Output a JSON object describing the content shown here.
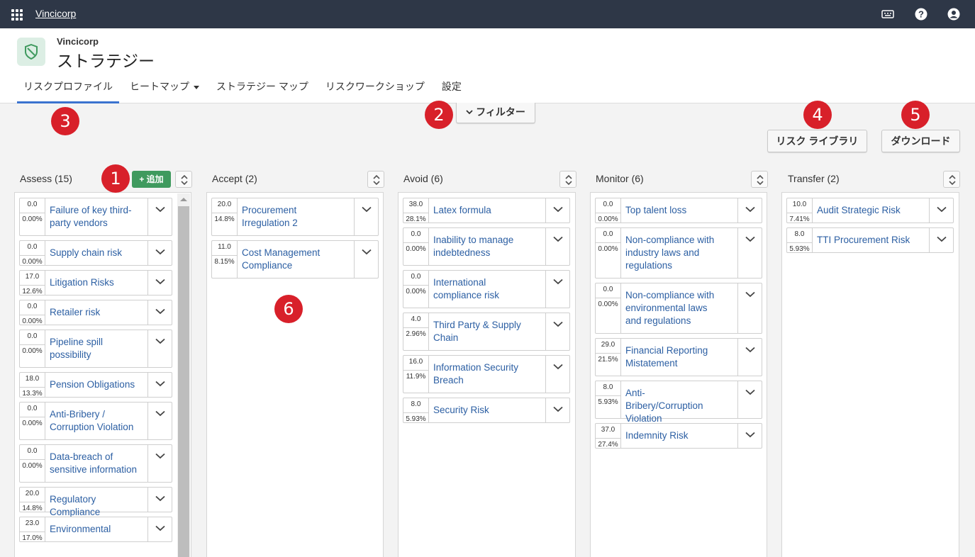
{
  "topbar": {
    "brand": "Vincicorp",
    "icons": [
      "apps-grid-icon",
      "keyboard-icon",
      "help-icon",
      "user-icon"
    ]
  },
  "header": {
    "org": "Vincicorp",
    "title": "ストラテジー"
  },
  "tabs": [
    {
      "label": "リスクプロファイル",
      "active": true
    },
    {
      "label": "ヒートマップ"
    },
    {
      "label": "ストラテジー マップ"
    },
    {
      "label": "リスクワークショップ"
    },
    {
      "label": "設定"
    }
  ],
  "filter_label": "フィルター",
  "buttons": {
    "library": "リスク ライブラリ",
    "download": "ダウンロード",
    "add": "+ 追加"
  },
  "callouts": [
    "1",
    "2",
    "3",
    "4",
    "5",
    "6"
  ],
  "columns": [
    {
      "title": "Assess (15)",
      "cards": [
        {
          "s1": "0.0",
          "s2": "0.00%",
          "name": "Failure of key third-party vendors"
        },
        {
          "s1": "0.0",
          "s2": "0.00%",
          "name": "Supply chain risk"
        },
        {
          "s1": "17.0",
          "s2": "12.6%",
          "name": "Litigation Risks"
        },
        {
          "s1": "0.0",
          "s2": "0.00%",
          "name": "Retailer risk"
        },
        {
          "s1": "0.0",
          "s2": "0.00%",
          "name": "Pipeline spill possibility"
        },
        {
          "s1": "18.0",
          "s2": "13.3%",
          "name": "Pension Obligations"
        },
        {
          "s1": "0.0",
          "s2": "0.00%",
          "name": "Anti-Bribery / Corruption Violation"
        },
        {
          "s1": "0.0",
          "s2": "0.00%",
          "name": "Data-breach of sensitive information"
        },
        {
          "s1": "20.0",
          "s2": "14.8%",
          "name": "Regulatory Compliance"
        },
        {
          "s1": "23.0",
          "s2": "17.0%",
          "name": "Environmental"
        }
      ]
    },
    {
      "title": "Accept (2)",
      "cards": [
        {
          "s1": "20.0",
          "s2": "14.8%",
          "name": "Procurement Irregulation 2"
        },
        {
          "s1": "11.0",
          "s2": "8.15%",
          "name": "Cost Management Compliance"
        }
      ]
    },
    {
      "title": "Avoid (6)",
      "cards": [
        {
          "s1": "38.0",
          "s2": "28.1%",
          "name": "Latex formula"
        },
        {
          "s1": "0.0",
          "s2": "0.00%",
          "name": "Inability to manage indebtedness"
        },
        {
          "s1": "0.0",
          "s2": "0.00%",
          "name": "International compliance risk"
        },
        {
          "s1": "4.0",
          "s2": "2.96%",
          "name": "Third Party & Supply Chain"
        },
        {
          "s1": "16.0",
          "s2": "11.9%",
          "name": "Information Security Breach"
        },
        {
          "s1": "8.0",
          "s2": "5.93%",
          "name": "Security Risk"
        }
      ]
    },
    {
      "title": "Monitor (6)",
      "cards": [
        {
          "s1": "0.0",
          "s2": "0.00%",
          "name": "Top talent loss"
        },
        {
          "s1": "0.0",
          "s2": "0.00%",
          "name": "Non-compliance with industry laws and regulations"
        },
        {
          "s1": "0.0",
          "s2": "0.00%",
          "name": "Non-compliance with environmental laws and regulations"
        },
        {
          "s1": "29.0",
          "s2": "21.5%",
          "name": "Financial Reporting Mistatement"
        },
        {
          "s1": "8.0",
          "s2": "5.93%",
          "name": "Anti-Bribery/Corruption Violation"
        },
        {
          "s1": "37.0",
          "s2": "27.4%",
          "name": "Indemnity Risk"
        }
      ]
    },
    {
      "title": "Transfer (2)",
      "cards": [
        {
          "s1": "10.0",
          "s2": "7.41%",
          "name": "Audit Strategic Risk"
        },
        {
          "s1": "8.0",
          "s2": "5.93%",
          "name": "TTI Procurement Risk"
        }
      ]
    }
  ]
}
